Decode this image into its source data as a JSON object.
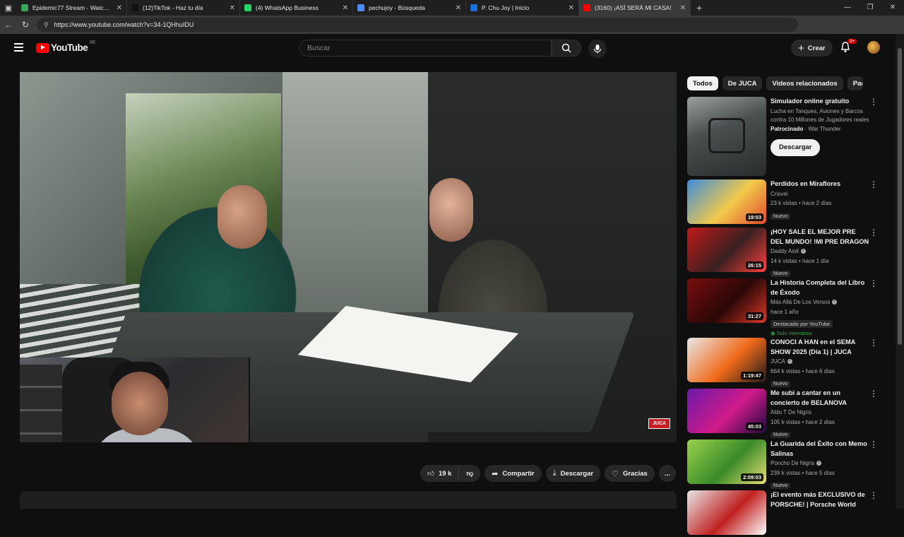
{
  "browser": {
    "tabs": [
      {
        "title": "Epidemic77 Stream - Watch Live",
        "favicon_color": "#3aa757",
        "width": 156,
        "active": false
      },
      {
        "title": "(12)TikTok - Haz tu día",
        "favicon_color": "#111111",
        "width": 160,
        "active": false
      },
      {
        "title": "(4) WhatsApp Business",
        "favicon_color": "#25d366",
        "width": 160,
        "active": false
      },
      {
        "title": "pechujoy - Búsqueda",
        "favicon_color": "#4c8bf5",
        "width": 160,
        "active": false
      },
      {
        "title": "P. Chu Joy | Inicio",
        "favicon_color": "#1b6fd8",
        "width": 160,
        "active": false
      },
      {
        "title": "(3160) ¡ASÍ SERÁ MI CASA! ",
        "favicon_color": "#ff0000",
        "width": 158,
        "active": true
      }
    ],
    "url": "https://www.youtube.com/watch?v=34-1QHhuIDU"
  },
  "header": {
    "logo_text": "YouTube",
    "region": "PE",
    "search_placeholder": "Buscar",
    "create_label": "Crear",
    "notifications_badge": "9+"
  },
  "video": {
    "watermark": "JUCA"
  },
  "actions": {
    "likes": "19 k",
    "share": "Compartir",
    "download": "Descargar",
    "thanks": "Gracias",
    "more": "..."
  },
  "chips": [
    "Todos",
    "De JUCA",
    "Videos relacionados",
    "Pa"
  ],
  "ad": {
    "title": "Simulador online gratuito",
    "description": "Lucha en Tanques, Aviones y Barcos contra 10 Millones de Jugadores reales",
    "sponsored": "Patrocinado",
    "advertiser": "War Thunder",
    "button": "Descargar"
  },
  "videos": [
    {
      "title": "Perdidos en Miraflores",
      "channel": "Crisvei",
      "verified": false,
      "stats": "23 k vistas • hace 2 días",
      "duration": "19:03",
      "tag": "Nuevo",
      "thumb": [
        "#3c8cd8",
        "#f2c94c",
        "#e04c2c"
      ]
    },
    {
      "title": "¡HOY SALE EL MEJOR PRE DEL MUNDO! !MI PRE DRAGON ...",
      "channel": "Daddy Aioli",
      "verified": true,
      "stats": "14 k vistas • hace 1 día",
      "duration": "26:15",
      "tag": "Nuevo",
      "thumb": [
        "#c21a1a",
        "#3a2020",
        "#ff4040"
      ]
    },
    {
      "title": "La Historia Completa del Libro de Éxodo",
      "channel": "Más Allá De Los Versos",
      "verified": true,
      "stats": "hace 1 año",
      "duration": "31:27",
      "tag": "Destacado por YouTube",
      "members": "Solo miembros",
      "thumb": [
        "#7a0e0e",
        "#2a0606",
        "#d83a2a"
      ]
    },
    {
      "title": "CONOCI A HAN en el SEMA SHOW 2025 (Día 1) | JUCA",
      "channel": "JUCA",
      "verified": true,
      "stats": "664 k vistas • hace 6 días",
      "duration": "1:19:47",
      "tag": "Nuevo",
      "thumb": [
        "#e8e8e8",
        "#f06a1a",
        "#1a1a1a"
      ]
    },
    {
      "title": "Me subí a cantar en un concierto de BELANOVA",
      "channel": "Aldo T De Nigris",
      "verified": false,
      "stats": "105 k vistas • hace 2 días",
      "duration": "45:03",
      "tag": "Nuevo",
      "thumb": [
        "#6a1aa8",
        "#d01a8a",
        "#1a0a3a"
      ]
    },
    {
      "title": "La Guarida del Éxito con Memo Salinas",
      "channel": "Poncho De Nigris",
      "verified": true,
      "stats": "239 k vistas • hace 5 días",
      "duration": "2:09:03",
      "tag": "Nuevo",
      "thumb": [
        "#9ad24a",
        "#3a8a2a",
        "#e8e070"
      ]
    },
    {
      "title": "¡El evento más EXCLUSIVO de PORSCHE! | Porsche World",
      "channel": "",
      "verified": false,
      "stats": "",
      "duration": "",
      "tag": "",
      "thumb": [
        "#e8e8e8",
        "#c02020",
        "#ffffff"
      ]
    }
  ]
}
